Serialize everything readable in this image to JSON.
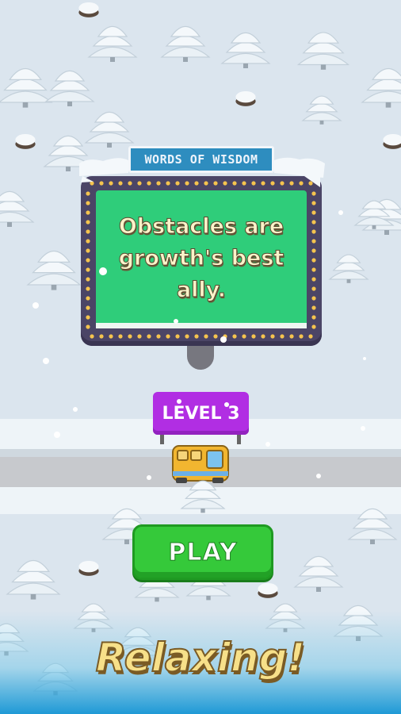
{
  "billboard": {
    "title": "WORDS OF WISDOM",
    "quote": "Obstacles are growth's best ally."
  },
  "level": {
    "label": "LEVEL 3"
  },
  "play_button": {
    "label": "PLAY"
  },
  "tagline": {
    "text": "Relaxing!"
  },
  "colors": {
    "background": "#dbe5ee",
    "billboard_screen": "#2fcd7a",
    "billboard_frame": "#4b4566",
    "title_plate": "#2e8dbf",
    "level_flag": "#b12ee3",
    "play_button": "#35c93a",
    "bus": "#f2b630",
    "tagline": "#f7e089"
  },
  "icons": [
    "snowy-pine-tree-icon",
    "snow-stump-icon",
    "school-bus-icon",
    "marquee-bulb-icon"
  ]
}
